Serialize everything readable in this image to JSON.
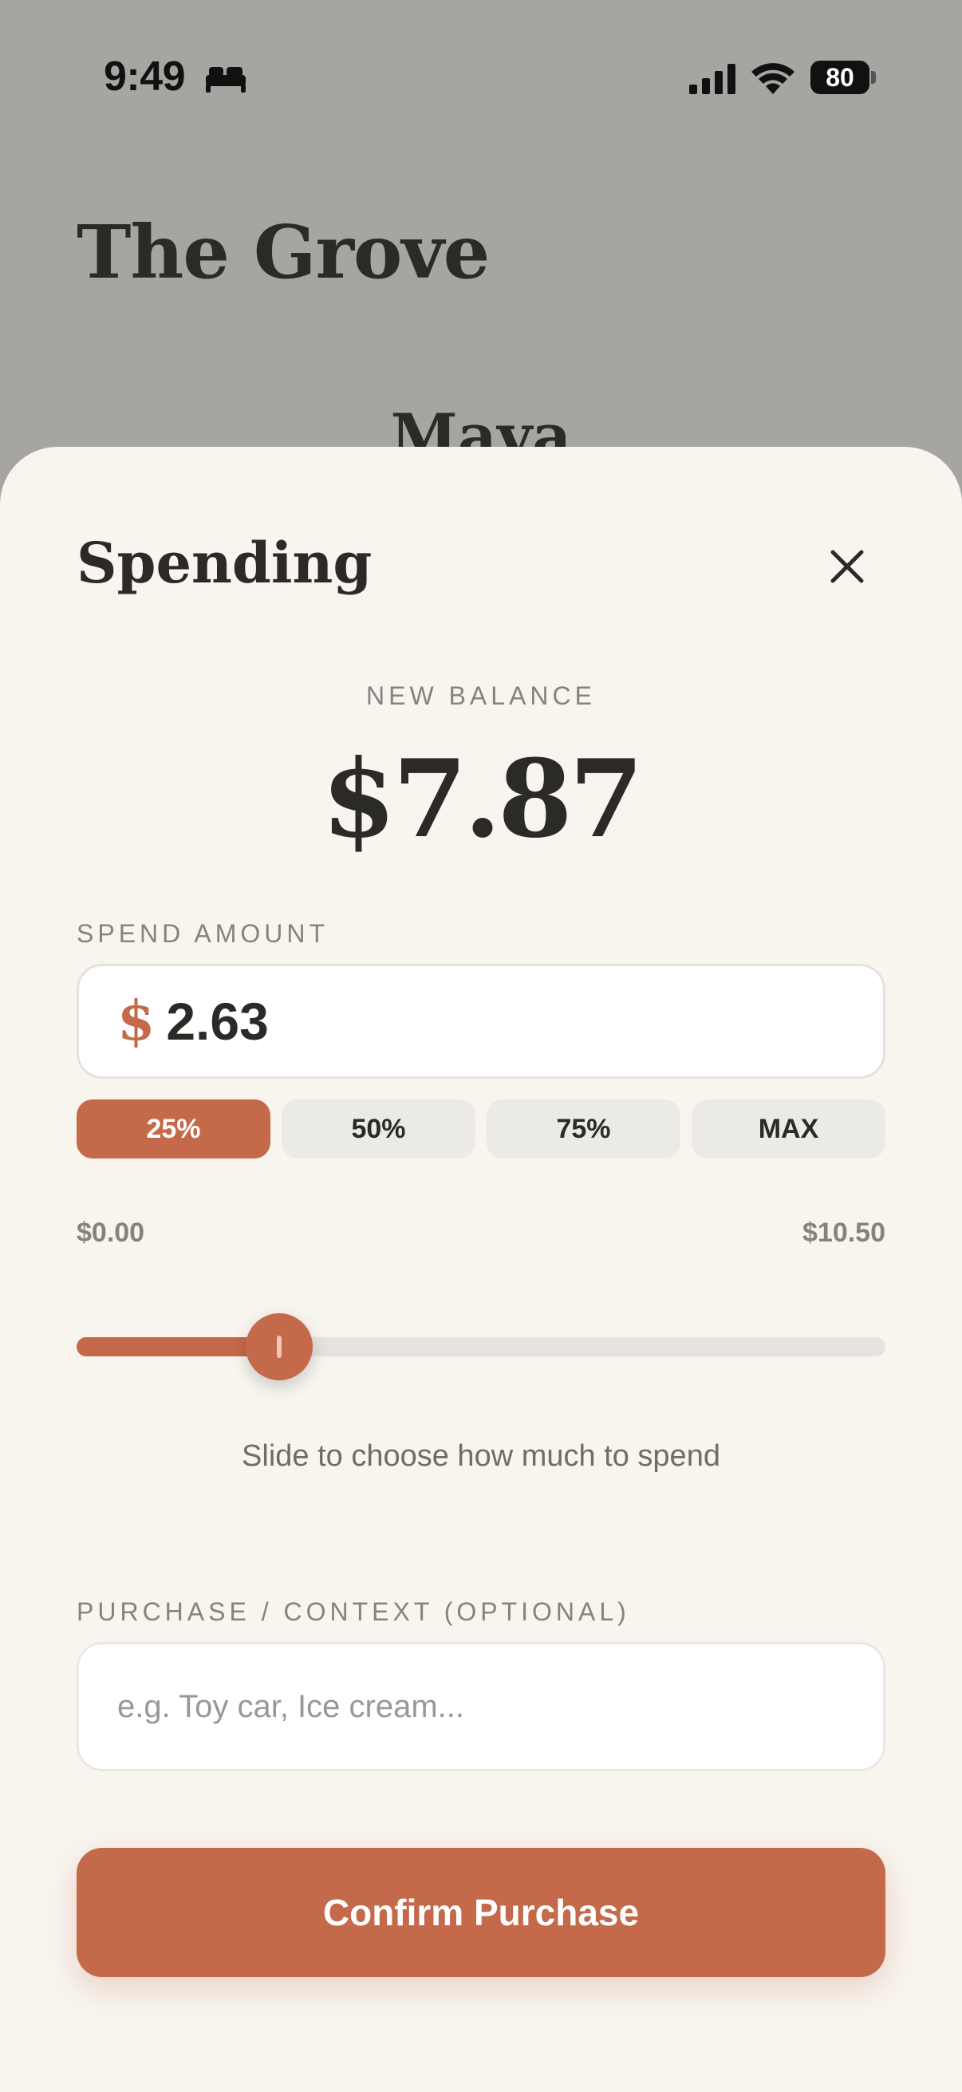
{
  "status_bar": {
    "time": "9:49",
    "battery": "80"
  },
  "app": {
    "title": "The Grove",
    "child_name": "Maya"
  },
  "sheet": {
    "title": "Spending",
    "balance_label": "NEW BALANCE",
    "balance_value": "$7.87",
    "spend_label": "SPEND AMOUNT",
    "currency_symbol": "$",
    "amount_value": "2.63",
    "presets": [
      "25%",
      "50%",
      "75%",
      "MAX"
    ],
    "active_preset_index": 0,
    "range_min": "$0.00",
    "range_max": "$10.50",
    "slider_fraction": 0.25,
    "slider_hint": "Slide to choose how much to spend",
    "context_label": "PURCHASE / CONTEXT (OPTIONAL)",
    "context_placeholder": "e.g. Toy car, Ice cream...",
    "confirm_label": "Confirm Purchase"
  },
  "colors": {
    "accent": "#c4694a",
    "sheet_bg": "#f8f5ef",
    "dim_bg": "#a6a5a1"
  },
  "icons": {
    "bed": "bed-icon",
    "signal": "signal-icon",
    "wifi": "wifi-icon",
    "close": "close-icon"
  }
}
